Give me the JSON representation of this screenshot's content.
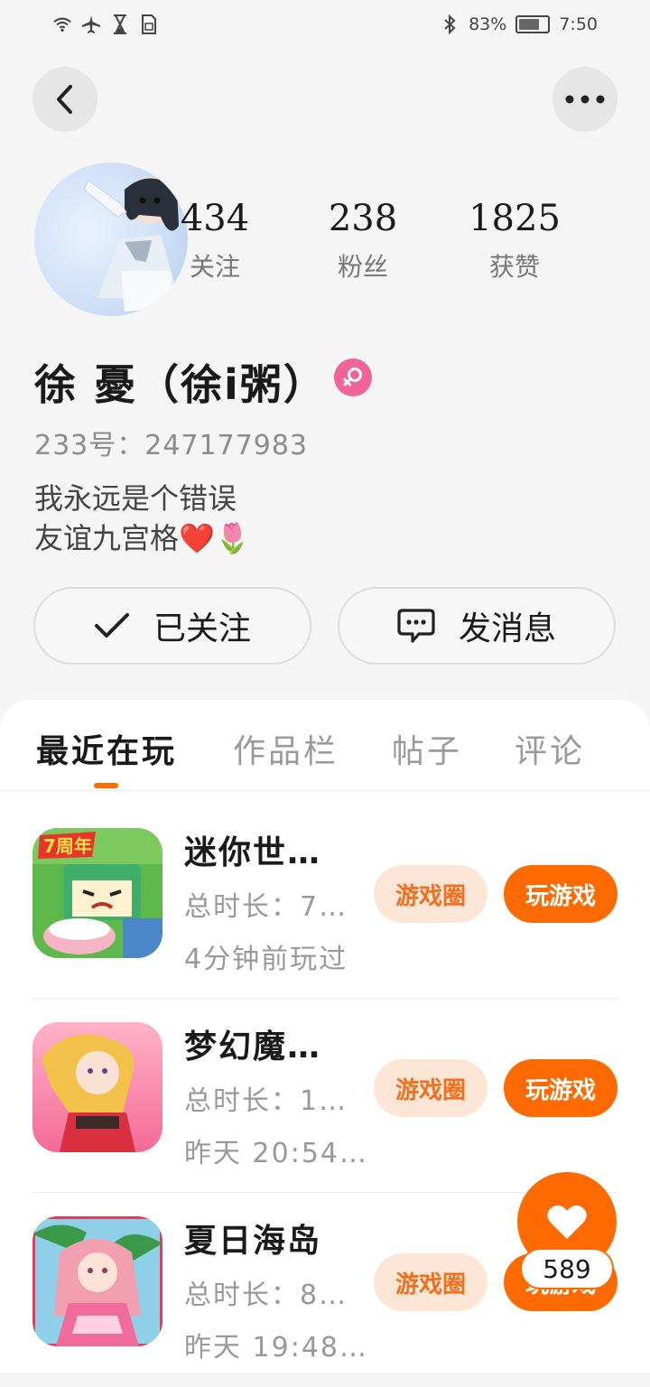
{
  "status_bar": {
    "battery_percent": "83%",
    "battery_level": 0.83,
    "time": "7:50",
    "icons": [
      "wifi-icon",
      "airplane-icon",
      "hourglass-icon",
      "sim-icon",
      "bluetooth-icon",
      "battery-icon"
    ]
  },
  "header": {
    "back_icon": "chevron-left-icon",
    "more_icon": "more-dots-icon"
  },
  "profile": {
    "stats": [
      {
        "value": "434",
        "label": "关注"
      },
      {
        "value": "238",
        "label": "粉丝"
      },
      {
        "value": "1825",
        "label": "获赞"
      }
    ],
    "name": "徐 憂（徐i粥）",
    "gender_icon": "female-icon",
    "uid": "233号：247177983",
    "bio_line1": "我永远是个错误",
    "bio_line2": "友谊九宫格❤️🌷"
  },
  "actions": {
    "followed_label": "已关注",
    "message_label": "发消息"
  },
  "tabs": [
    {
      "label": "最近在玩",
      "active": true
    },
    {
      "label": "作品栏",
      "active": false
    },
    {
      "label": "帖子",
      "active": false
    },
    {
      "label": "评论",
      "active": false
    }
  ],
  "games": [
    {
      "title": "迷你世…",
      "line1": "总时长：7…",
      "line2": "4分钟前玩过",
      "circle_label": "游戏圈",
      "play_label": "玩游戏",
      "icon_text": "7周年"
    },
    {
      "title": "梦幻魔…",
      "line1": "总时长：1…",
      "line2": "昨天 20:54…",
      "circle_label": "游戏圈",
      "play_label": "玩游戏"
    },
    {
      "title": "夏日海岛",
      "line1": "总时长：8…",
      "line2": "昨天 19:48…",
      "circle_label": "游戏圈",
      "play_label": "玩游戏"
    }
  ],
  "like_float": {
    "count": "589"
  },
  "colors": {
    "accent": "#ff6a00",
    "accent_soft": "#fde6d6",
    "gender_pink": "#f0649a"
  }
}
